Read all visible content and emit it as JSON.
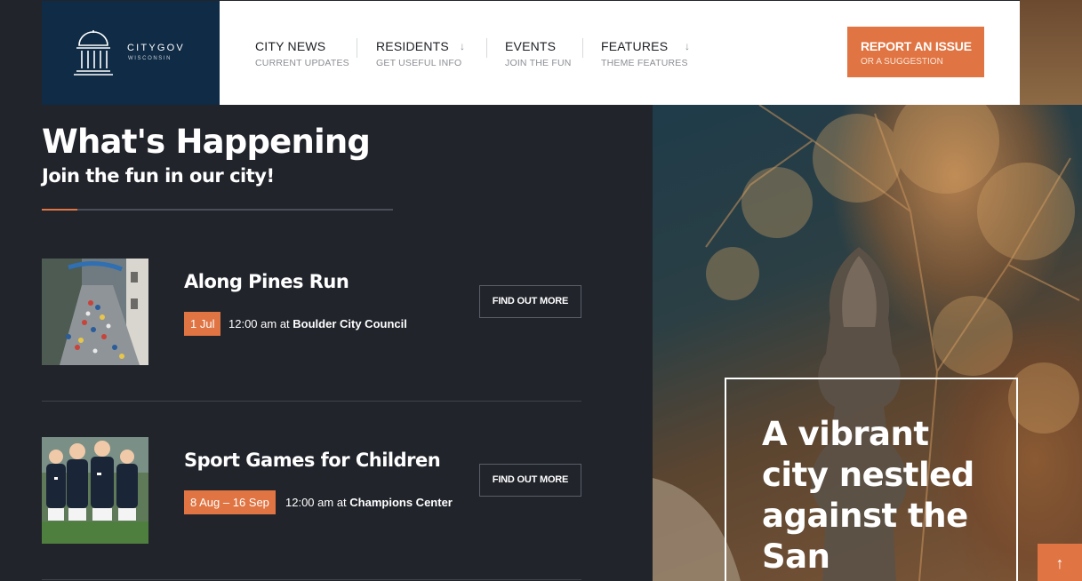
{
  "logo": {
    "name": "CITYGOV",
    "sub": "WISCONSIN",
    "icon": "capitol-dome-icon"
  },
  "nav": {
    "items": [
      {
        "label": "CITY NEWS",
        "sub": "CURRENT UPDATES",
        "has_dropdown": false
      },
      {
        "label": "RESIDENTS",
        "sub": "GET USEFUL INFO",
        "has_dropdown": true
      },
      {
        "label": "EVENTS",
        "sub": "JOIN THE FUN",
        "has_dropdown": false
      },
      {
        "label": "FEATURES",
        "sub": "THEME FEATURES",
        "has_dropdown": true
      }
    ],
    "caret": "↓",
    "report": {
      "label": "REPORT AN ISSUE",
      "sub": "OR A SUGGESTION"
    }
  },
  "section": {
    "title": "What's Happening",
    "subtitle": "Join the fun in our city!"
  },
  "events": [
    {
      "title": "Along Pines Run",
      "date": "1 Jul",
      "time": "12:00 am at",
      "venue": "Boulder City Council",
      "cta": "FIND OUT MORE"
    },
    {
      "title": "Sport Games for Children",
      "date": "8 Aug – 16 Sep",
      "time": "12:00 am at",
      "venue": "Champions Center",
      "cta": "FIND OUT MORE"
    }
  ],
  "hero": {
    "quote": "A vibrant city nestled against the San"
  },
  "back_to_top": "↑",
  "colors": {
    "accent": "#e07442",
    "logo_bg": "#0f2b45",
    "page_bg": "#21242b"
  }
}
